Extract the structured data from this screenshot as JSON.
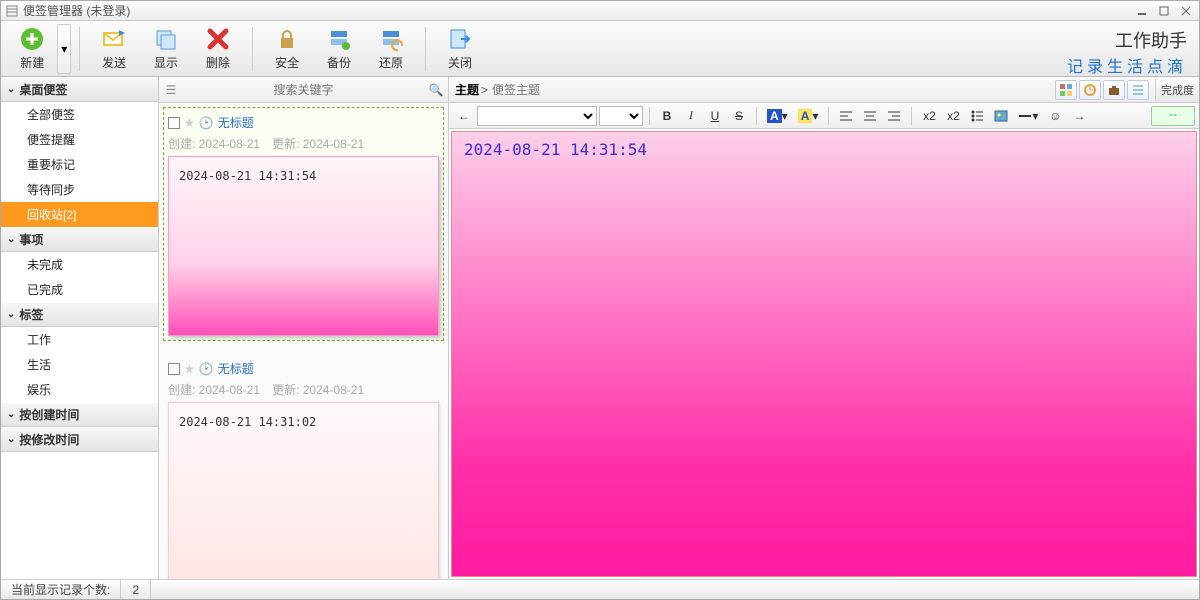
{
  "window": {
    "title": "便签管理器 (未登录)"
  },
  "brand": {
    "line1": "工作助手",
    "line2": "记录生活点滴"
  },
  "toolbar": {
    "new_": "新建",
    "send": "发送",
    "show": "显示",
    "delete": "删除",
    "security": "安全",
    "backup": "备份",
    "restore": "还原",
    "close": "关闭"
  },
  "sidebar": {
    "sections": [
      {
        "title": "桌面便签",
        "items": [
          {
            "label": "全部便签"
          },
          {
            "label": "便签提醒"
          },
          {
            "label": "重要标记"
          },
          {
            "label": "等待同步"
          },
          {
            "label": "回收站[2]",
            "active": true
          }
        ]
      },
      {
        "title": "事项",
        "items": [
          {
            "label": "未完成"
          },
          {
            "label": "已完成"
          }
        ]
      },
      {
        "title": "标签",
        "items": [
          {
            "label": "工作"
          },
          {
            "label": "生活"
          },
          {
            "label": "娱乐"
          }
        ]
      },
      {
        "title": "按创建时间",
        "items": []
      },
      {
        "title": "按修改时间",
        "items": []
      }
    ]
  },
  "search": {
    "placeholder": "搜索关键字"
  },
  "notes": [
    {
      "title": "无标题",
      "created_label": "创建:",
      "created": "2024-08-21",
      "updated_label": "更新:",
      "updated": "2024-08-21",
      "body": "2024-08-21 14:31:54",
      "selected": true
    },
    {
      "title": "无标题",
      "created_label": "创建:",
      "created": "2024-08-21",
      "updated_label": "更新:",
      "updated": "2024-08-21",
      "body": "2024-08-21 14:31:02",
      "selected": false
    }
  ],
  "topic": {
    "label": "主题",
    "sep": ">",
    "placeholder": "便签主题",
    "done_label": "完成度"
  },
  "editor": {
    "font": "",
    "bold": "B",
    "italic": "I",
    "underline": "U",
    "strike": "S",
    "stamp": "2024-08-21 14:31:54",
    "done_val": "--"
  },
  "status": {
    "label": "当前显示记录个数:",
    "count": "2"
  },
  "icons": {
    "new_color": "#5bbf2f",
    "send_color": "#f2c23a",
    "delete_color": "#d33",
    "security_color": "#c9a24a",
    "backup_color": "#4a90d9",
    "restore_color": "#4a90d9",
    "close_color": "#3a8ee6"
  }
}
